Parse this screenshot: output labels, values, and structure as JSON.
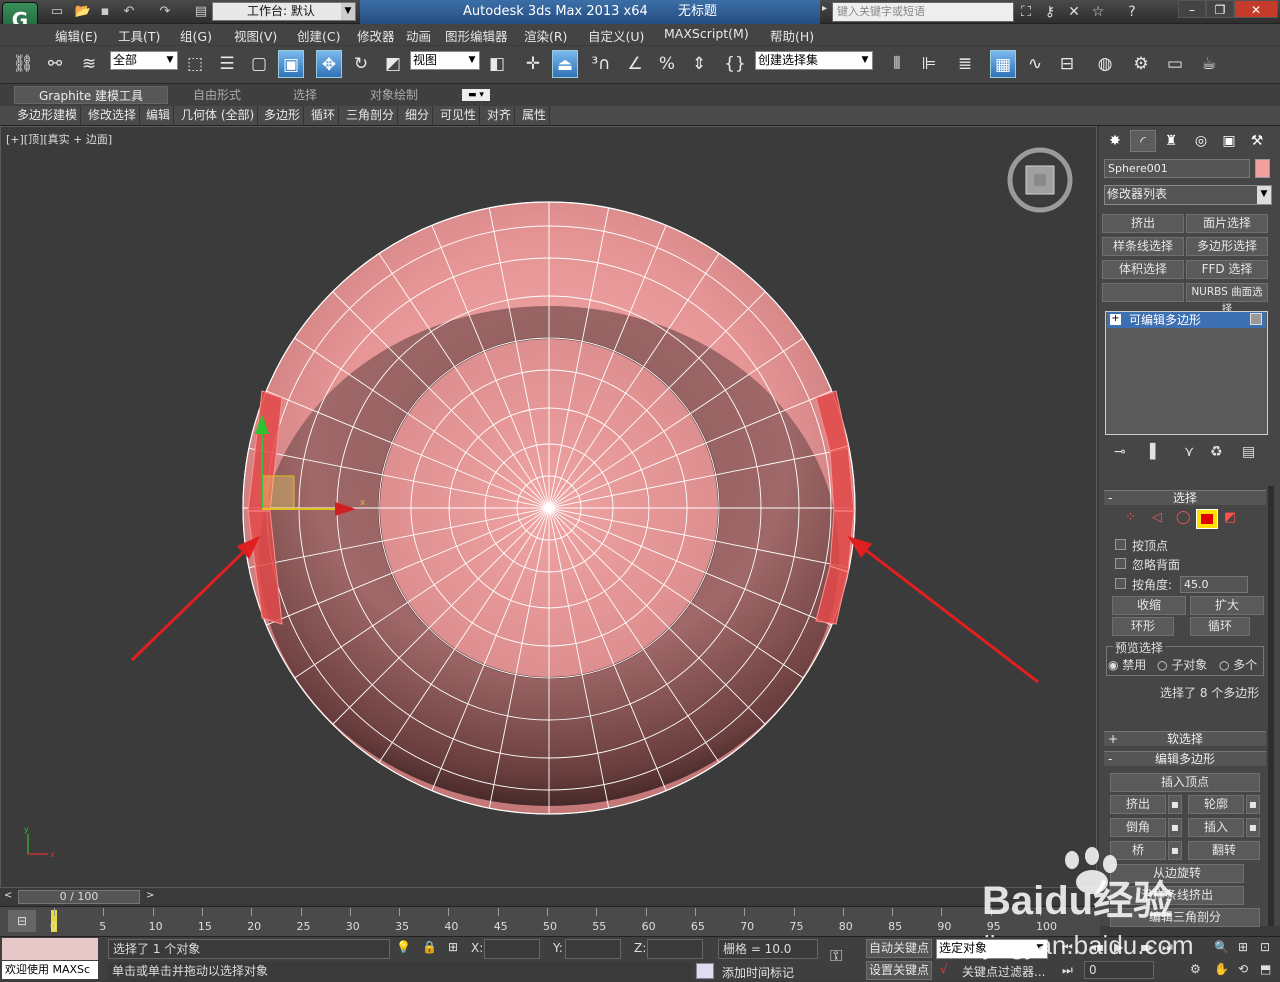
{
  "titlebar": {
    "app_title": "Autodesk 3ds Max  2013 x64",
    "document": "无标题",
    "workspace_label": "工作台: 默认",
    "search_placeholder": "键入关键字或短语"
  },
  "menu": [
    "编辑(E)",
    "工具(T)",
    "组(G)",
    "视图(V)",
    "创建(C)",
    "修改器",
    "动画",
    "图形编辑器",
    "渲染(R)",
    "自定义(U)",
    "MAXScript(M)",
    "帮助(H)"
  ],
  "toolbar": {
    "selection_filter": "全部",
    "ref_coord": "视图",
    "named_selection": "创建选择集"
  },
  "ribbon": {
    "tabs": [
      "Graphite 建模工具",
      "自由形式",
      "选择",
      "对象绘制"
    ],
    "commands": [
      "多边形建模",
      "修改选择",
      "编辑",
      "几何体 (全部)",
      "多边形",
      "循环",
      "三角剖分",
      "细分",
      "可见性",
      "对齐",
      "属性"
    ]
  },
  "viewport": {
    "label": "[+][顶][真实 + 边面]",
    "axis_x": "x",
    "axis_y": "y"
  },
  "command_panel": {
    "object_name": "Sphere001",
    "object_color": "#f2a0a0",
    "modifier_list": "修改器列表",
    "modifier_buttons": [
      "挤出",
      "面片选择",
      "样条线选择",
      "多边形选择",
      "体积选择",
      "FFD 选择",
      "",
      "NURBS 曲面选择"
    ],
    "stack_item": "可编辑多边形",
    "selection_rollout": {
      "title": "选择",
      "by_vertex": "按顶点",
      "ignore_backfacing": "忽略背面",
      "by_angle": "按角度:",
      "angle_value": "45.0",
      "shrink": "收缩",
      "grow": "扩大",
      "ring": "环形",
      "loop": "循环",
      "preview_title": "预览选择",
      "preview_options": [
        "禁用",
        "子对象",
        "多个"
      ],
      "status": "选择了 8 个多边形"
    },
    "soft_selection_title": "软选择",
    "edit_poly_rollout": {
      "title": "编辑多边形",
      "insert_vertex": "插入顶点",
      "extrude": "挤出",
      "outline": "轮廓",
      "bevel": "倒角",
      "inset": "插入",
      "bridge": "桥",
      "flip": "翻转",
      "hinge": "从边旋转",
      "extrude_along": "沿样条线挤出",
      "edit_tri": "编辑三角剖分"
    }
  },
  "timeline": {
    "frame_display": "0 / 100",
    "ticks": [
      "0",
      "5",
      "10",
      "15",
      "20",
      "25",
      "30",
      "35",
      "40",
      "45",
      "50",
      "55",
      "60",
      "65",
      "70",
      "75",
      "80",
      "85",
      "90",
      "95",
      "100"
    ]
  },
  "statusbar": {
    "welcome": "欢迎使用 MAXSc",
    "selected": "选择了 1 个对象",
    "prompt": "单击或单击并拖动以选择对象",
    "x_label": "X:",
    "y_label": "Y:",
    "z_label": "Z:",
    "grid": "栅格 = 10.0",
    "add_time_tag": "添加时间标记",
    "auto_key": "自动关键点",
    "set_key": "设置关键点",
    "selected_object": "选定对象",
    "key_filters": "关键点过滤器...",
    "frame_value": "0"
  },
  "watermark": {
    "brand": "Baidu经验",
    "url": "jingyan.baidu.com"
  }
}
